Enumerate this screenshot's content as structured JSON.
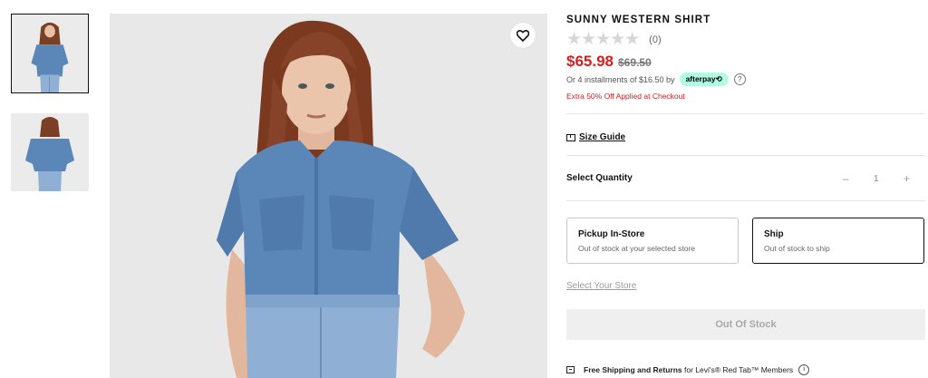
{
  "product": {
    "title": "SUNNY WESTERN SHIRT",
    "stars": "★★★★★",
    "rating_count": "(0)",
    "sale_price": "$65.98",
    "original_price": "$69.50",
    "installments_text": "Or 4 installments of $16.50 by",
    "afterpay_label": "afterpay⟲",
    "help_icon_glyph": "?",
    "promo_text": "Extra 50% Off Applied at Checkout"
  },
  "size_guide_label": "Size Guide",
  "quantity": {
    "label": "Select Quantity",
    "minus": "–",
    "value": "1",
    "plus": "+"
  },
  "fulfillment": {
    "options": [
      {
        "title": "Pickup In-Store",
        "subtitle": "Out of stock at your selected store",
        "selected": false
      },
      {
        "title": "Ship",
        "subtitle": "Out of stock to ship",
        "selected": true
      }
    ],
    "select_store_label": "Select Your Store"
  },
  "add_button_label": "Out Of Stock",
  "shipping_banner": {
    "bold_text": "Free Shipping and Returns",
    "rest_text": " for Levi's® Red Tab™ Members",
    "info_glyph": "i"
  },
  "colors": {
    "sale_red": "#d21f1f",
    "afterpay_mint": "#b2fce4",
    "denim": "#5a86b8"
  },
  "icons": [
    "heart-icon",
    "ruler-icon",
    "help-icon",
    "box-icon",
    "info-icon"
  ]
}
